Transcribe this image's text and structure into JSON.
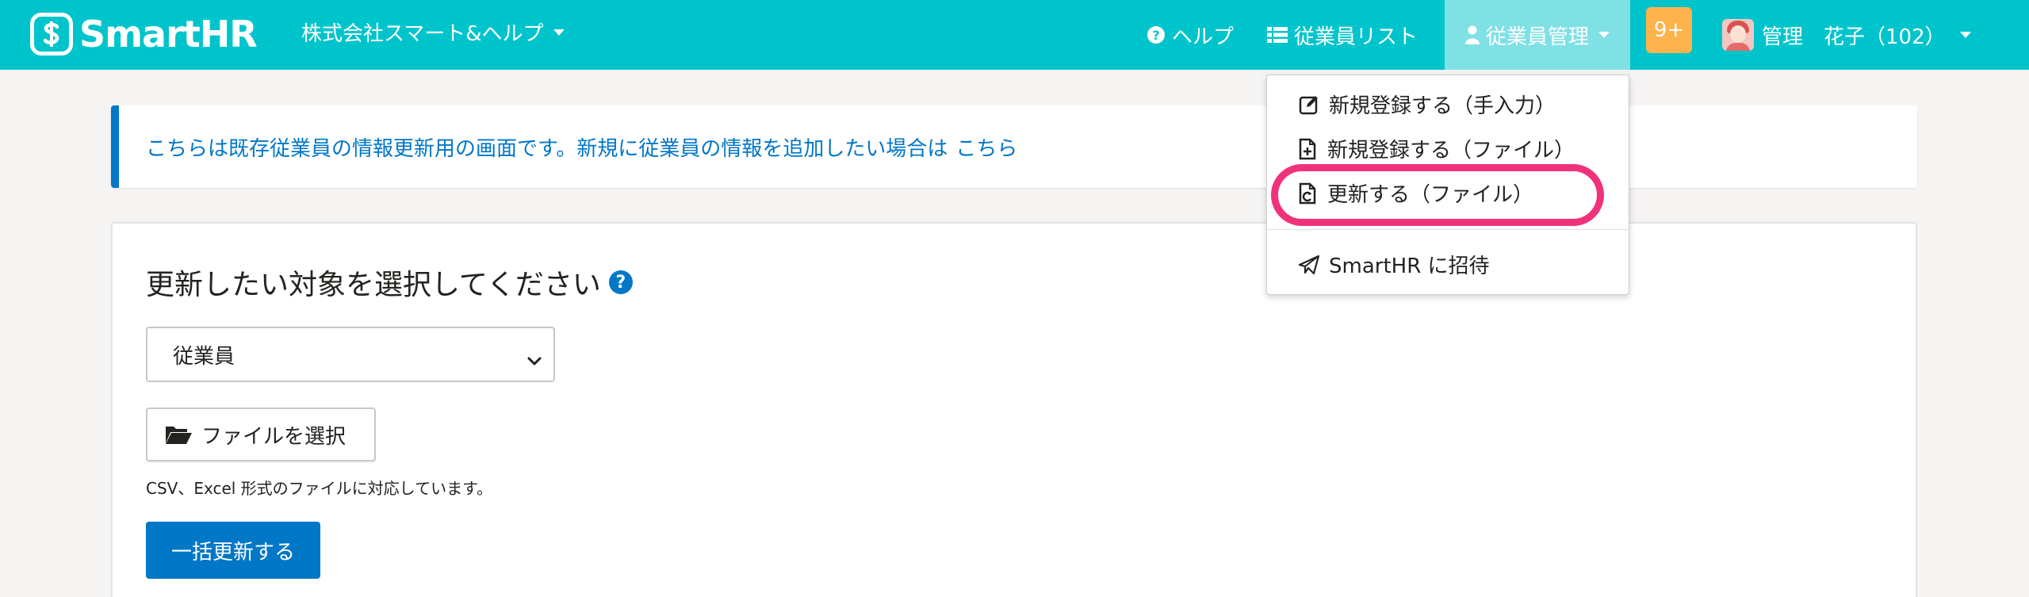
{
  "header": {
    "logo_text": "SmartHR",
    "company": "株式会社スマート&ヘルプ",
    "nav": {
      "help": "ヘルプ",
      "employee_list": "従業員リスト",
      "employee_manage": "従業員管理"
    },
    "notification_badge": "9+",
    "user_name": "管理　花子（102）"
  },
  "banner": {
    "text": "こちらは既存従業員の情報更新用の画面です。新規に従業員の情報を追加したい場合は",
    "link": "こちら"
  },
  "card": {
    "title": "更新したい対象を選択してください",
    "help_icon": "?",
    "select_value": "従業員",
    "file_button": "ファイルを選択",
    "hint": "CSV、Excel 形式のファイルに対応しています。",
    "submit": "一括更新する"
  },
  "dropdown": {
    "items": [
      {
        "label": "新規登録する（手入力）",
        "icon": "edit-icon"
      },
      {
        "label": "新規登録する（ファイル）",
        "icon": "file-add-icon"
      },
      {
        "label": "更新する（ファイル）",
        "icon": "file-refresh-icon"
      },
      {
        "label": "SmartHR に招待",
        "icon": "send-icon"
      }
    ]
  },
  "colors": {
    "header_bg": "#00c4cc",
    "accent": "#0077c7",
    "badge": "#ffb34d",
    "highlight": "#f0327a"
  }
}
